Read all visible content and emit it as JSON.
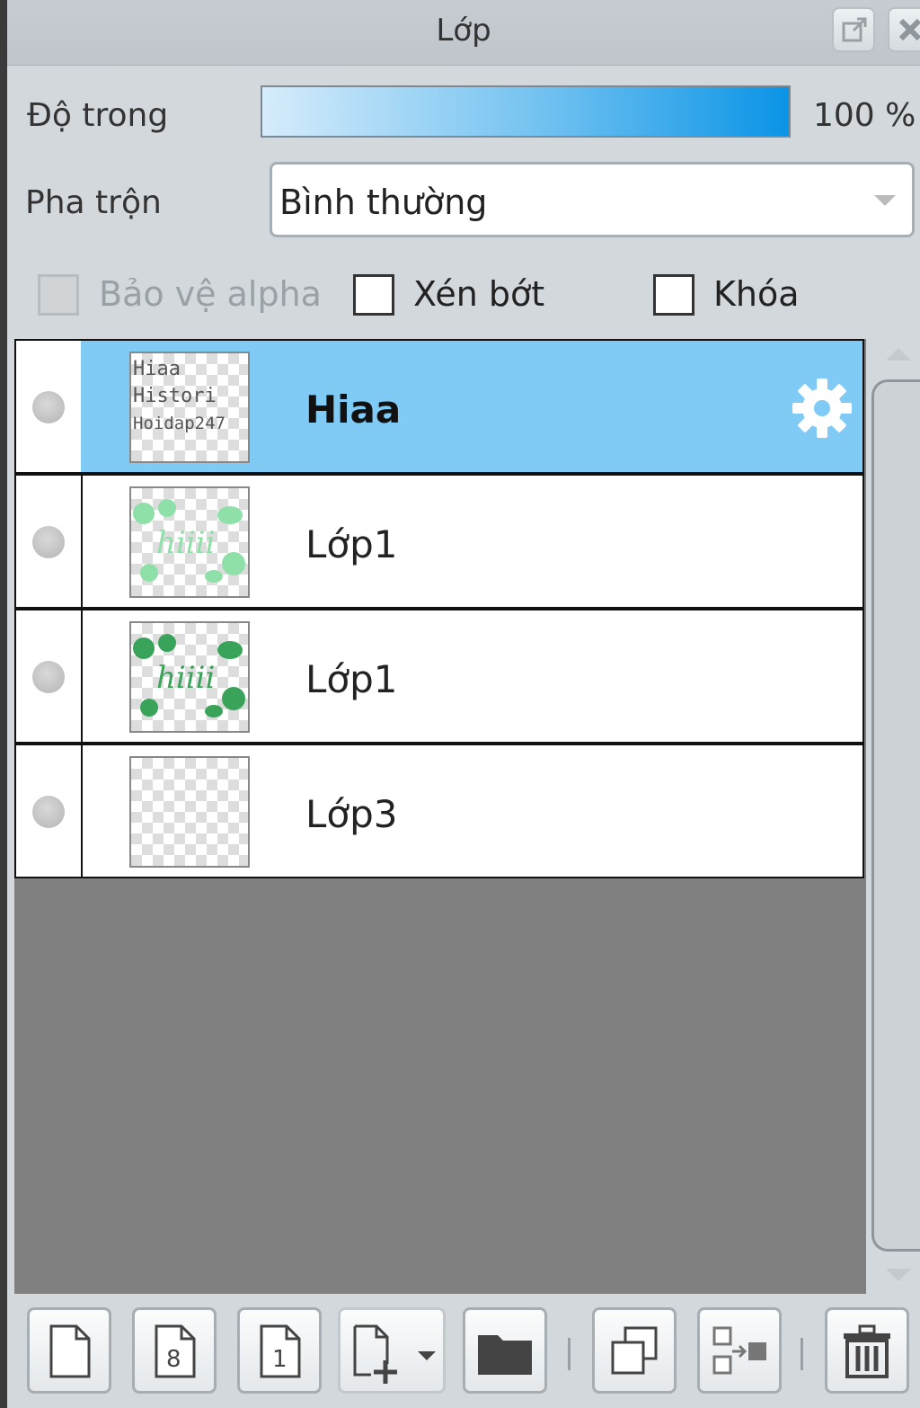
{
  "panel": {
    "title": "Lớp"
  },
  "opacity": {
    "label": "Độ trong",
    "value": "100 %",
    "level": 1.0
  },
  "blend": {
    "label": "Pha trộn",
    "value": "Bình thường"
  },
  "options": {
    "protect_alpha": {
      "label": "Bảo vệ alpha",
      "checked": false,
      "enabled": false
    },
    "clip": {
      "label": "Xén bớt",
      "checked": false,
      "enabled": true
    },
    "lock": {
      "label": "Khóa",
      "checked": false,
      "enabled": true
    }
  },
  "layers": [
    {
      "name": "Hiaa",
      "selected": true,
      "thumb_text": [
        "Hiaa",
        "Histori",
        "Hoidap247"
      ]
    },
    {
      "name": "Lớp1",
      "selected": false
    },
    {
      "name": "Lớp1",
      "selected": false
    },
    {
      "name": "Lớp3",
      "selected": false
    }
  ],
  "colors": {
    "selected_row": "#7fcbf5",
    "opacity_bar_end": "#0a94e6",
    "leaf_light": "#8fe0a8",
    "leaf_dark": "#3aa35a"
  },
  "icons": [
    "popout-icon",
    "close-icon",
    "settings-gear-icon",
    "new-layer-icon",
    "new-8bit-layer-icon",
    "new-1bit-layer-icon",
    "new-layer-menu-icon",
    "new-folder-icon",
    "duplicate-layer-icon",
    "merge-down-icon",
    "delete-layer-icon"
  ]
}
